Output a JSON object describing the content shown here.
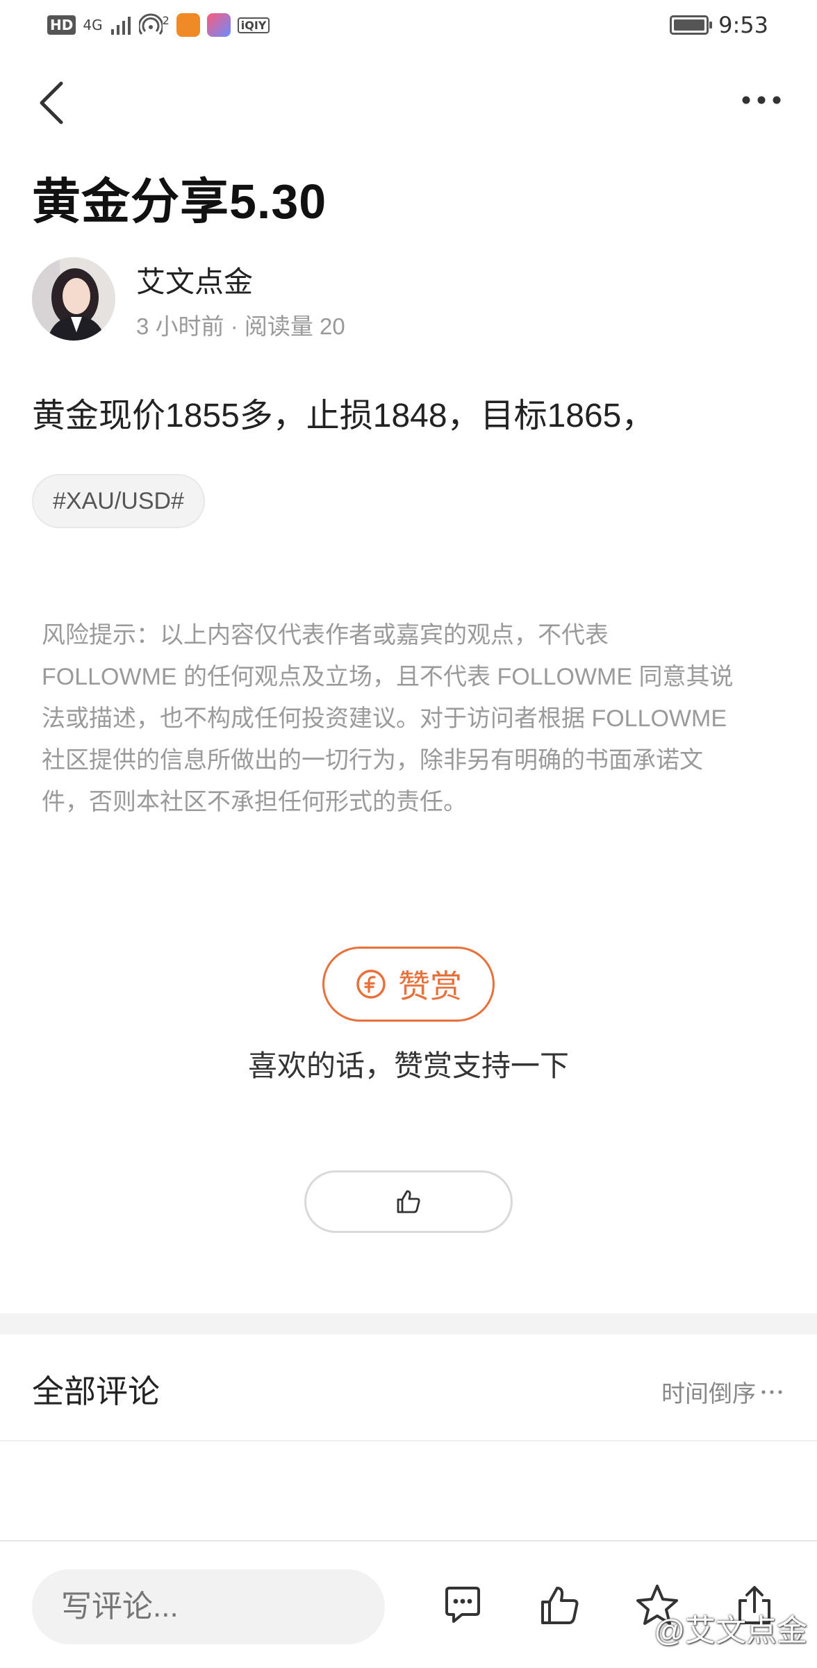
{
  "status_bar": {
    "hd": "HD",
    "network": "4G",
    "wifi_badge": "2",
    "iqiyi": "iQIY",
    "time": "9:53"
  },
  "post": {
    "title": "黄金分享5.30",
    "author": "艾文点金",
    "meta": "3 小时前 · 阅读量 20",
    "content": "黄金现价1855多，止损1848，目标1865，",
    "tag": "#XAU/USD#"
  },
  "risk_notice": {
    "lines": [
      "风险提示：以上内容仅代表作者或嘉宾的观点，不代表",
      "FOLLOWME 的任何观点及立场，且不代表 FOLLOWME 同意其说",
      "法或描述，也不构成任何投资建议。对于访问者根据 FOLLOWME",
      "社区提供的信息所做出的一切行为，除非另有明确的书面承诺文",
      "件，否则本社区不承担任何形式的责任。"
    ]
  },
  "reward": {
    "button_label": "赞赏",
    "hint": "喜欢的话，赞赏支持一下"
  },
  "comments": {
    "title": "全部评论",
    "sort_label": "时间倒序"
  },
  "bottom_bar": {
    "input_placeholder": "写评论..."
  },
  "watermark": "@艾文点金",
  "colors": {
    "accent": "#e8703a",
    "muted": "#9a9a9a",
    "divider": "#f3f3f3"
  },
  "icons": {
    "back": "chevron-left-icon",
    "more": "more-horizontal-icon",
    "reward": "coin-icon",
    "like": "thumbs-up-icon",
    "comment": "comment-icon",
    "favorite": "star-icon",
    "share": "share-icon"
  }
}
